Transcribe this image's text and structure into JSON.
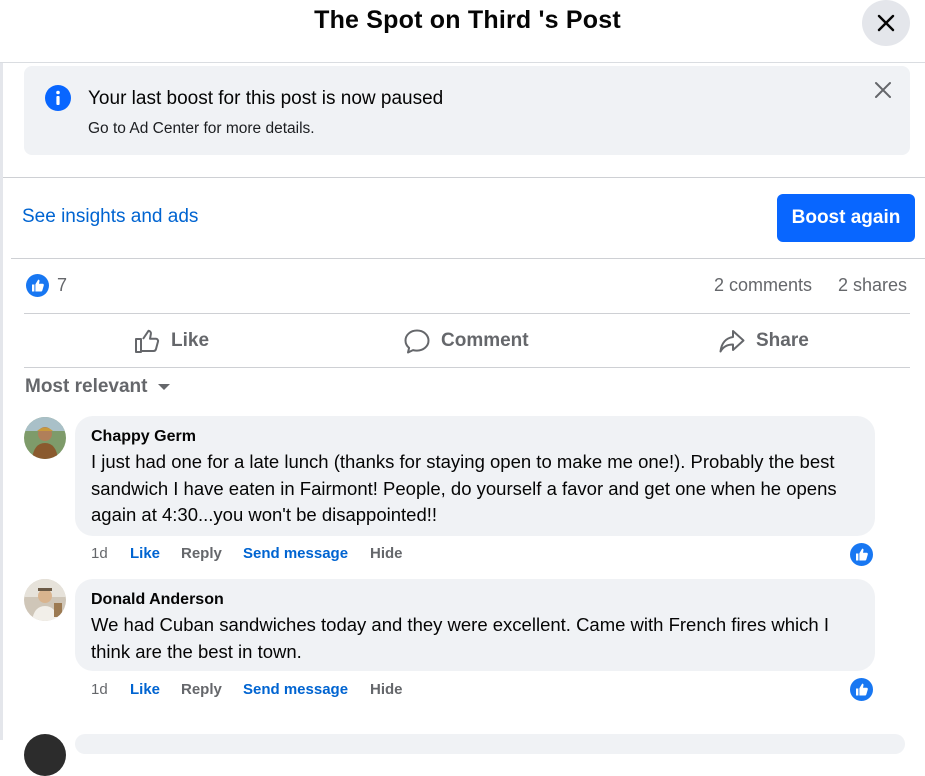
{
  "dialog": {
    "title": "The Spot on Third 's Post"
  },
  "banner": {
    "title": "Your last boost for this post is now paused",
    "subtitle": "Go to Ad Center for more details."
  },
  "insights": {
    "link_label": "See insights and ads",
    "boost_label": "Boost again"
  },
  "stats": {
    "reactions": "7",
    "comments": "2 comments",
    "shares": "2 shares"
  },
  "actions": {
    "like": "Like",
    "comment": "Comment",
    "share": "Share"
  },
  "sort": {
    "label": "Most relevant"
  },
  "comments": [
    {
      "author": "Chappy Germ",
      "text": "I just had one for a late lunch (thanks for staying open to make me one!). Probably the best sandwich I have eaten in Fairmont! People, do yourself a favor and get one when he opens again at 4:30...you won't be disappointed!!",
      "time": "1d",
      "like": "Like",
      "reply": "Reply",
      "send": "Send message",
      "hide": "Hide"
    },
    {
      "author": "Donald Anderson",
      "text": "We had Cuban sandwiches today and they were excellent. Came with French fires which I think are the best in town.",
      "time": "1d",
      "like": "Like",
      "reply": "Reply",
      "send": "Send message",
      "hide": "Hide"
    }
  ],
  "colors": {
    "primary": "#0866ff",
    "link": "#0064d1",
    "muted": "#65676b",
    "surface": "#f0f2f5"
  }
}
